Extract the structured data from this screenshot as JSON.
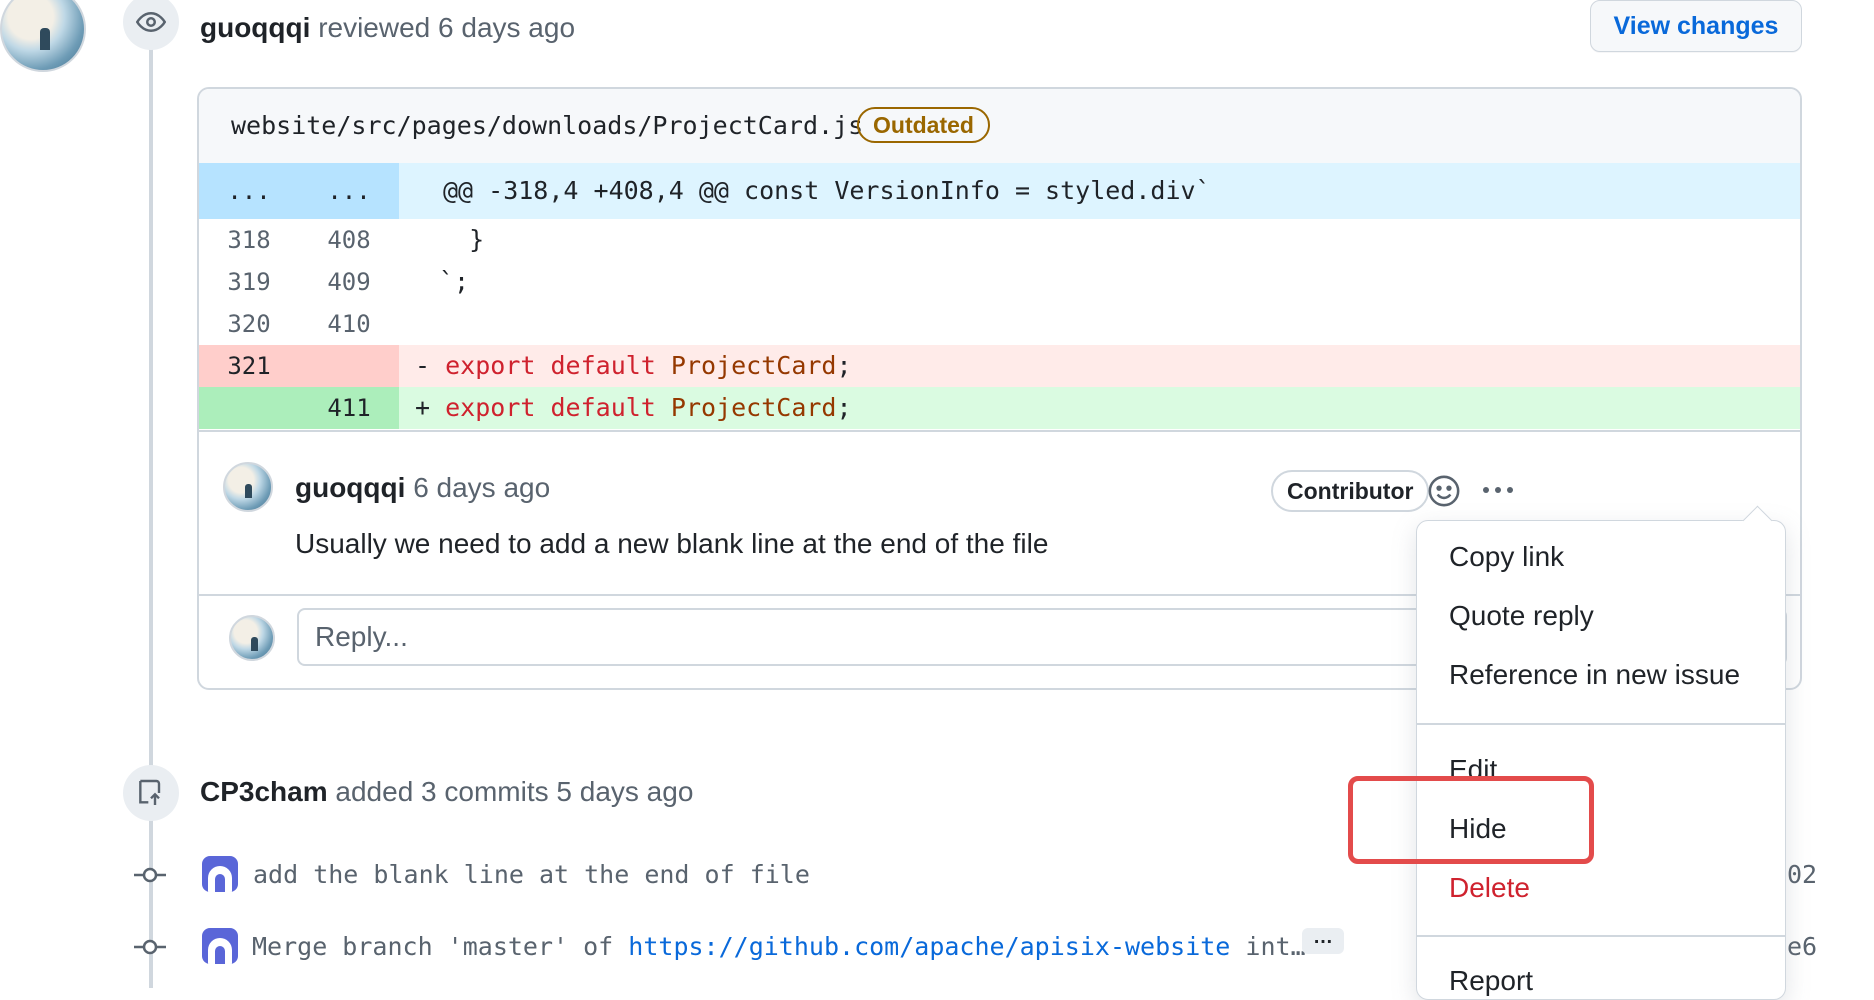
{
  "review": {
    "author": "guoqqqi",
    "action_text": "reviewed 6 days ago",
    "view_changes_label": "View changes"
  },
  "file": {
    "path": "website/src/pages/downloads/ProjectCard.js",
    "status_badge": "Outdated",
    "hunk": {
      "old": "...",
      "new": "...",
      "header": "@@ -318,4 +408,4 @@ const VersionInfo = styled.div`"
    },
    "lines": [
      {
        "old": "318",
        "new": "408",
        "text": "  }"
      },
      {
        "old": "319",
        "new": "409",
        "text": "`;"
      },
      {
        "old": "320",
        "new": "410",
        "text": ""
      }
    ],
    "deleted": {
      "old": "321",
      "sign": "-",
      "kw1": "export",
      "kw2": "default",
      "name": "ProjectCard",
      "punct": ";"
    },
    "added": {
      "new": "411",
      "sign": "+",
      "kw1": "export",
      "kw2": "default",
      "name": "ProjectCard",
      "punct": ";"
    }
  },
  "comment": {
    "author": "guoqqqi",
    "time": "6 days ago",
    "role_badge": "Contributor",
    "body": "Usually we need to add a new blank line at the end of the file",
    "reply_placeholder": "Reply..."
  },
  "commits_event": {
    "author": "CP3cham",
    "action_text": "added 3 commits 5 days ago",
    "commits": [
      {
        "message": "add the blank line at the end of file",
        "sha_fragment": "02"
      },
      {
        "message_prefix": "Merge branch 'master' of ",
        "link": "https://github.com/apache/apisix-website",
        "message_suffix": " int…",
        "more": "…",
        "sha_fragment": "e6"
      }
    ]
  },
  "menu": {
    "items": [
      "Copy link",
      "Quote reply",
      "Reference in new issue",
      "Edit",
      "Hide",
      "Delete",
      "Report"
    ],
    "highlighted": "Hide"
  },
  "colors": {
    "accent": "#0969da",
    "danger": "#cf222e",
    "outdated": "#9a6700",
    "highlight_box": "#e34b4b"
  }
}
